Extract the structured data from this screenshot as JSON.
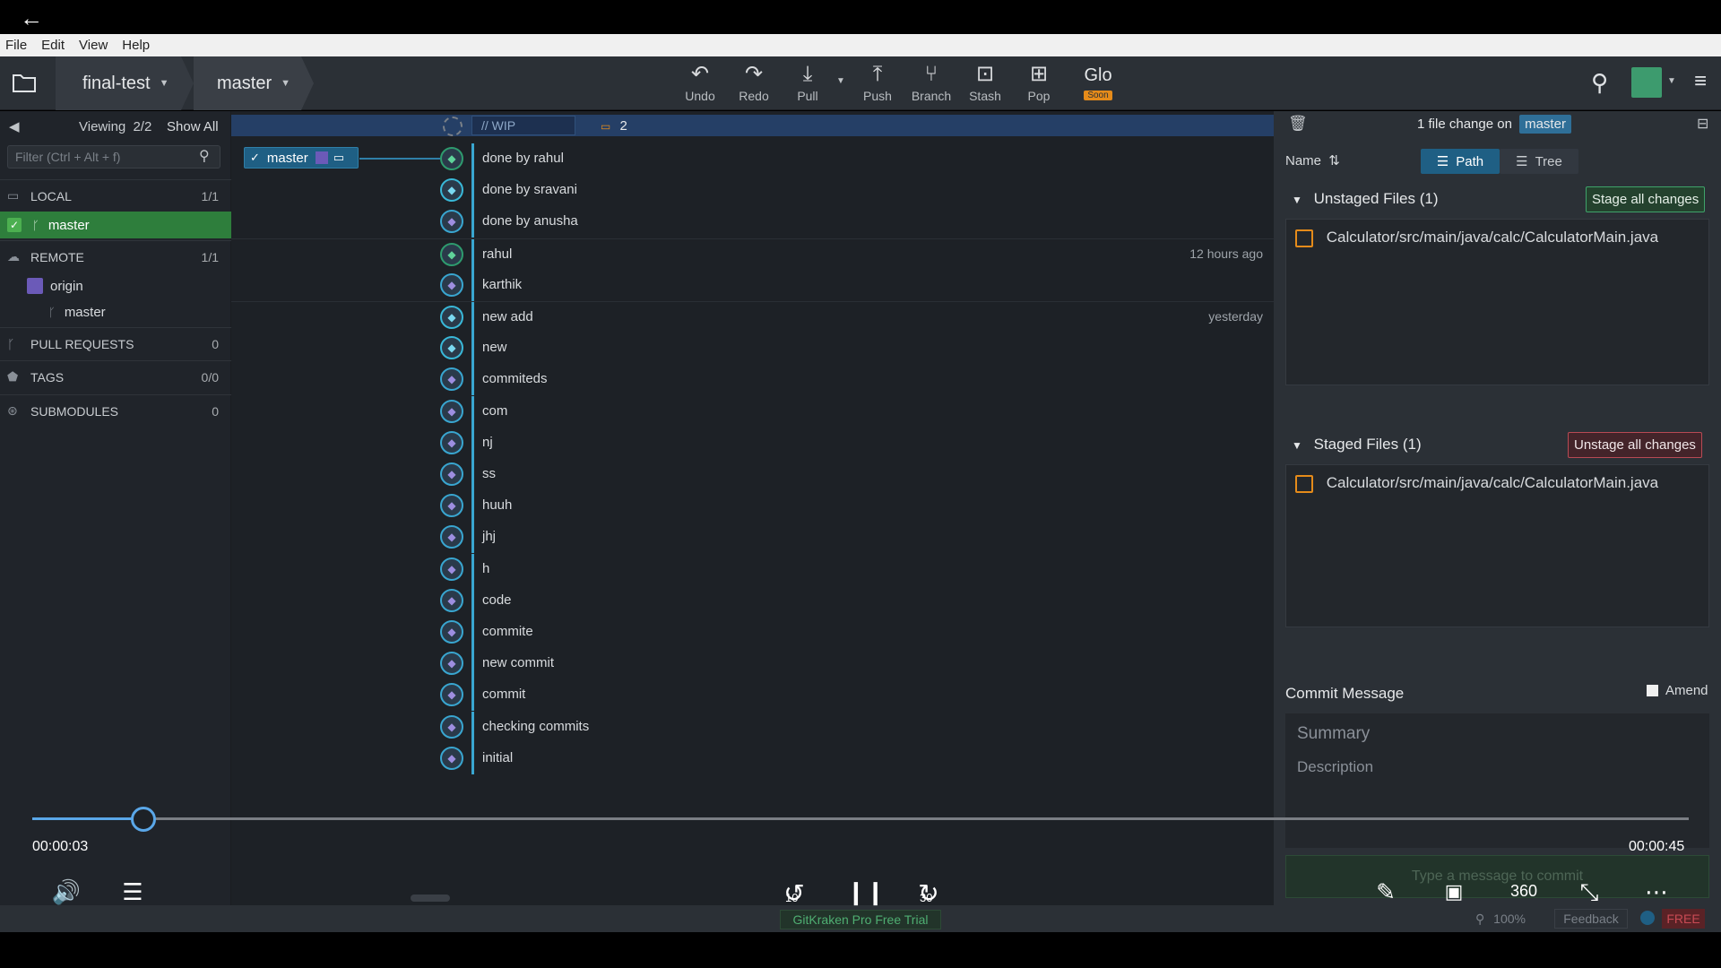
{
  "menubar": {
    "items": [
      "File",
      "Edit",
      "View",
      "Help"
    ]
  },
  "toolbar": {
    "repo": "final-test",
    "branch": "master",
    "buttons": [
      {
        "label": "Undo",
        "icon": "undo-icon"
      },
      {
        "label": "Redo",
        "icon": "redo-icon"
      },
      {
        "label": "Pull",
        "icon": "pull-icon"
      },
      {
        "label": "Push",
        "icon": "push-icon"
      },
      {
        "label": "Branch",
        "icon": "branch-icon"
      },
      {
        "label": "Stash",
        "icon": "stash-icon"
      },
      {
        "label": "Pop",
        "icon": "pop-icon"
      }
    ],
    "glo": {
      "label": "Glo",
      "badge": "Soon"
    }
  },
  "sidebar": {
    "viewing_label": "Viewing",
    "viewing_count": "2/2",
    "show_all": "Show All",
    "filter_placeholder": "Filter (Ctrl + Alt + f)",
    "local": {
      "label": "LOCAL",
      "count": "1/1",
      "branch": "master"
    },
    "remote": {
      "label": "REMOTE",
      "count": "1/1",
      "origin": "origin",
      "branch": "master"
    },
    "pull_requests": {
      "label": "PULL REQUESTS",
      "count": "0"
    },
    "tags": {
      "label": "TAGS",
      "count": "0/0"
    },
    "submodules": {
      "label": "SUBMODULES",
      "count": "0"
    }
  },
  "graph": {
    "wip_label": "// WIP",
    "wip_count": "2",
    "branch_tag": "master",
    "commits": [
      {
        "msg": "done by rahul",
        "time": "",
        "avatar": "green"
      },
      {
        "msg": "done by sravani",
        "time": "",
        "avatar": "cyan"
      },
      {
        "msg": "done by anusha",
        "time": "",
        "avatar": "blue"
      },
      {
        "msg": "rahul",
        "time": "12 hours ago",
        "avatar": "green"
      },
      {
        "msg": "karthik",
        "time": "",
        "avatar": "blue"
      },
      {
        "msg": "new add",
        "time": "yesterday",
        "avatar": "cyan"
      },
      {
        "msg": "new",
        "time": "",
        "avatar": "cyan"
      },
      {
        "msg": "commiteds",
        "time": "",
        "avatar": "blue"
      },
      {
        "msg": "com",
        "time": "",
        "avatar": "blue"
      },
      {
        "msg": "nj",
        "time": "",
        "avatar": "blue"
      },
      {
        "msg": "ss",
        "time": "",
        "avatar": "blue"
      },
      {
        "msg": "huuh",
        "time": "",
        "avatar": "blue"
      },
      {
        "msg": "jhj",
        "time": "",
        "avatar": "blue"
      },
      {
        "msg": "h",
        "time": "",
        "avatar": "blue"
      },
      {
        "msg": "code",
        "time": "",
        "avatar": "blue"
      },
      {
        "msg": "commite",
        "time": "",
        "avatar": "blue"
      },
      {
        "msg": "new commit",
        "time": "",
        "avatar": "blue"
      },
      {
        "msg": "commit",
        "time": "",
        "avatar": "blue"
      },
      {
        "msg": "checking commits",
        "time": "",
        "avatar": "blue"
      },
      {
        "msg": "initial",
        "time": "",
        "avatar": "blue"
      }
    ]
  },
  "rightpanel": {
    "file_change_text": "1 file change on",
    "branch": "master",
    "sort_label": "Name",
    "view_path": "Path",
    "view_tree": "Tree",
    "unstaged_title": "Unstaged Files (1)",
    "stage_all": "Stage all changes",
    "unstaged_file": "Calculator/src/main/java/calc/CalculatorMain.java",
    "staged_title": "Staged Files (1)",
    "unstage_all": "Unstage all changes",
    "staged_file": "Calculator/src/main/java/calc/CalculatorMain.java",
    "commit_message_title": "Commit Message",
    "amend_label": "Amend",
    "summary_placeholder": "Summary",
    "description_placeholder": "Description",
    "commit_button_placeholder": "Type a message to commit"
  },
  "video": {
    "current_time": "00:00:03",
    "total_time": "00:00:45",
    "progress": 0.067,
    "rewind_label": "10",
    "forward_label": "30",
    "vr_label": "360"
  },
  "statusbar": {
    "trial": "GitKraken Pro Free Trial",
    "zoom": "100%",
    "feedback": "Feedback",
    "plan": "FREE"
  }
}
